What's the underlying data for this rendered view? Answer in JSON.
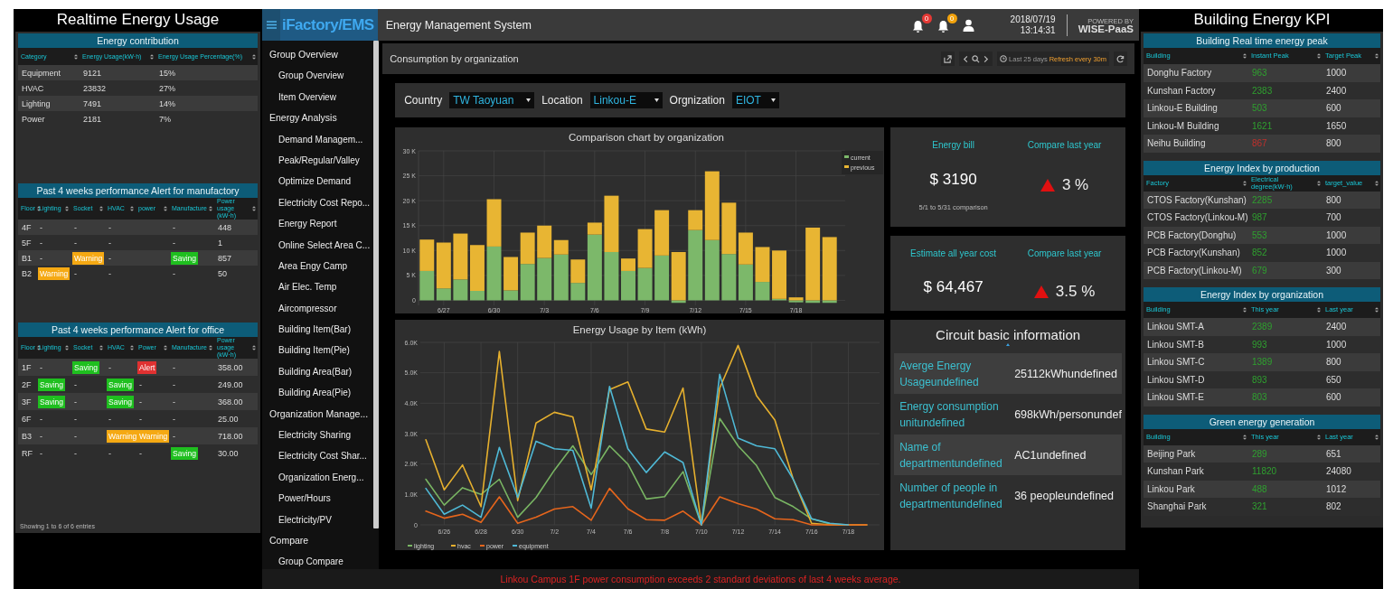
{
  "left_panel": {
    "title": "Realtime Energy Usage",
    "tables": [
      {
        "title": "Energy contribution",
        "columns": [
          "Category",
          "Energy Usage(kW·h)",
          "Energy Usage Percentage(%)"
        ],
        "rows": [
          [
            "Equipment",
            "9121",
            "15%"
          ],
          [
            "HVAC",
            "23832",
            "27%"
          ],
          [
            "Lighting",
            "7491",
            "14%"
          ],
          [
            "Power",
            "2181",
            "7%"
          ]
        ]
      },
      {
        "title": "Past 4 weeks performance Alert for manufactory",
        "columns": [
          "Floor",
          "Lighting",
          "Socket",
          "HVAC",
          "power",
          "Manufacture",
          "Power usage (kW·h)"
        ],
        "rows": [
          [
            "4F",
            "-",
            "-",
            "-",
            null,
            "-",
            "448"
          ],
          [
            "5F",
            "-",
            "-",
            "-",
            null,
            "-",
            "1"
          ],
          [
            "B1",
            "-",
            {
              "text": "Warning",
              "color": "#f5a913"
            },
            "-",
            null,
            {
              "text": "Saving",
              "color": "#1fbf1f"
            },
            "857"
          ],
          [
            "B2",
            {
              "text": "Warning",
              "color": "#f5a913"
            },
            "-",
            "-",
            null,
            "-",
            "50"
          ]
        ]
      },
      {
        "title": "Past 4 weeks performance Alert for office",
        "columns": [
          "Floor",
          "Lighting",
          "Socket",
          "HVAC",
          "Power",
          "Manufacture",
          "Power usage (kW·h)"
        ],
        "rows": [
          [
            "1F",
            "-",
            {
              "text": "Saving",
              "color": "#1fbf1f"
            },
            "-",
            {
              "text": "Alert",
              "color": "#e03131"
            },
            "-",
            "358.00"
          ],
          [
            "2F",
            {
              "text": "Saving",
              "color": "#1fbf1f"
            },
            "-",
            {
              "text": "Saving",
              "color": "#1fbf1f"
            },
            "-",
            "-",
            "249.00"
          ],
          [
            "3F",
            {
              "text": "Saving",
              "color": "#1fbf1f"
            },
            "-",
            {
              "text": "Saving",
              "color": "#1fbf1f"
            },
            "-",
            "-",
            "368.00"
          ],
          [
            "6F",
            "-",
            "-",
            "-",
            "-",
            "-",
            "25.00"
          ],
          [
            "B3",
            "-",
            "-",
            {
              "text": "Warning",
              "color": "#f5a913"
            },
            {
              "text": "Warning",
              "color": "#f5a913"
            },
            "-",
            "718.00"
          ],
          [
            "RF",
            "-",
            "-",
            "-",
            "-",
            {
              "text": "Saving",
              "color": "#1fbf1f"
            },
            "30.00"
          ]
        ]
      }
    ],
    "footer": "Showing 1 to 6 of 6 entries"
  },
  "header": {
    "logo": "iFactory/EMS",
    "title": "Energy Management System",
    "notifications": [
      {
        "count": "0",
        "color": "#e53935"
      },
      {
        "count": "0",
        "color": "#f2a20c"
      }
    ],
    "date": "2018/07/19",
    "time": "13:14:31",
    "powered_by": "POWERED BY",
    "brand": "WISE-PaaS"
  },
  "sidebar": {
    "items": [
      {
        "label": "Group Overview",
        "children": [
          {
            "label": "Group Overview"
          },
          {
            "label": "Item Overview"
          }
        ]
      },
      {
        "label": "Energy Analysis",
        "children": [
          {
            "label": "Demand Managem..."
          },
          {
            "label": "Peak/Regular/Valley"
          },
          {
            "label": "Optimize Demand"
          },
          {
            "label": "Electricity Cost Repo..."
          },
          {
            "label": "Energy Report"
          },
          {
            "label": "Online Select Area C..."
          },
          {
            "label": "Area Engy Camp"
          },
          {
            "label": "Air Elec. Temp"
          },
          {
            "label": "Aircompressor"
          },
          {
            "label": "Building Item(Bar)"
          },
          {
            "label": "Building Item(Pie)"
          },
          {
            "label": "Building Area(Bar)"
          },
          {
            "label": "Building Area(Pie)"
          }
        ]
      },
      {
        "label": "Organization Manage...",
        "children": [
          {
            "label": "Electricity Sharing"
          },
          {
            "label": "Electricity Cost Shar..."
          },
          {
            "label": "Organization Energ..."
          },
          {
            "label": "Power/Hours"
          },
          {
            "label": "Electricity/PV"
          }
        ]
      },
      {
        "label": "Compare",
        "children": [
          {
            "label": "Group Compare"
          }
        ]
      }
    ]
  },
  "page_bar": {
    "title": "Consumption by organization",
    "range": "Last 25 days",
    "refresh": "Refresh every 30m"
  },
  "filters": [
    {
      "label": "Country",
      "value": "TW Taoyuan"
    },
    {
      "label": "Location",
      "value": "Linkou-E"
    },
    {
      "label": "Orgnization",
      "value": "EIOT"
    }
  ],
  "bar_chart": {
    "chart_data": {
      "type": "bar",
      "title": "Comparison chart by organization",
      "stacked": true,
      "grid": true,
      "legend": "top-right",
      "categories": [
        null,
        "6/27",
        null,
        null,
        "6/30",
        null,
        null,
        "7/3",
        null,
        null,
        "7/6",
        null,
        null,
        "7/9",
        null,
        null,
        "7/12",
        null,
        null,
        "7/15",
        null,
        null,
        "7/18",
        null,
        null
      ],
      "series": [
        {
          "name": "current",
          "color": "#7cb86a",
          "values": [
            5900,
            2400,
            4200,
            1900,
            10800,
            2000,
            7300,
            8500,
            9200,
            3500,
            13200,
            9700,
            5900,
            6500,
            9000,
            -500,
            14100,
            12100,
            9300,
            7200,
            3700,
            300,
            -400,
            -500,
            -500
          ]
        },
        {
          "name": "previous",
          "color": "#e8b533",
          "values": [
            6300,
            9200,
            9200,
            9200,
            9500,
            6700,
            6300,
            6500,
            2900,
            4700,
            2400,
            11300,
            2500,
            7800,
            9100,
            9700,
            4000,
            13800,
            10300,
            6400,
            7000,
            9700,
            600,
            14600,
            12700
          ]
        }
      ],
      "ylim": [
        -1000,
        30000
      ],
      "yticks": [
        {
          "value": 0,
          "label": "0"
        },
        {
          "value": 5000,
          "label": "5 K"
        },
        {
          "value": 10000,
          "label": "10 K"
        },
        {
          "value": 15000,
          "label": "15 K"
        },
        {
          "value": 20000,
          "label": "20 K"
        },
        {
          "value": 25000,
          "label": "25 K"
        },
        {
          "value": 30000,
          "label": "30 K"
        }
      ]
    }
  },
  "line_chart": {
    "chart_data": {
      "type": "line",
      "title": "Energy Usage by Item (kWh)",
      "grid": true,
      "legend": "bottom",
      "categories": [
        null,
        "6/26",
        null,
        "6/28",
        null,
        "6/30",
        null,
        "7/2",
        null,
        "7/4",
        null,
        "7/6",
        null,
        "7/8",
        null,
        "7/10",
        null,
        "7/12",
        null,
        "7/14",
        null,
        "7/16",
        null,
        "7/18",
        null
      ],
      "series": [
        {
          "name": "lighting",
          "color": "#79b563",
          "values": [
            1500,
            650,
            1220,
            1000,
            1500,
            250,
            900,
            1800,
            2600,
            1650,
            2600,
            2000,
            850,
            930,
            1750,
            0,
            3500,
            2600,
            1950,
            900,
            600,
            200,
            30,
            0,
            0
          ]
        },
        {
          "name": "hvac",
          "color": "#e6b02e",
          "values": [
            2800,
            1150,
            1970,
            600,
            5700,
            800,
            3350,
            3700,
            3550,
            1150,
            4450,
            4700,
            3150,
            3050,
            4500,
            0,
            4500,
            5900,
            4250,
            3450,
            1500,
            50,
            0,
            0,
            0
          ]
        },
        {
          "name": "power",
          "color": "#e5651c",
          "values": [
            450,
            220,
            350,
            80,
            920,
            50,
            250,
            520,
            600,
            150,
            1200,
            530,
            170,
            150,
            450,
            0,
            920,
            700,
            520,
            200,
            170,
            0,
            0,
            0,
            0
          ]
        },
        {
          "name": "equipment",
          "color": "#4fb9d6",
          "values": [
            1200,
            350,
            650,
            250,
            2550,
            900,
            2750,
            2500,
            2450,
            550,
            4550,
            2500,
            1720,
            2400,
            2050,
            0,
            4950,
            2850,
            2600,
            2500,
            1500,
            200,
            50,
            0,
            null
          ]
        }
      ],
      "ylim": [
        0,
        6000
      ],
      "yticks": [
        {
          "value": 0,
          "label": "0"
        },
        {
          "value": 1000,
          "label": "1.0K"
        },
        {
          "value": 2000,
          "label": "2.0K"
        },
        {
          "value": 3000,
          "label": "3.0K"
        },
        {
          "value": 4000,
          "label": "4.0K"
        },
        {
          "value": 5000,
          "label": "5.0K"
        },
        {
          "value": 6000,
          "label": "6.0K"
        }
      ]
    }
  },
  "cost_cards": [
    {
      "label": "Energy bill",
      "value": "$ 3190",
      "note": "5/1 to 5/31 comparison",
      "compare_label": "Compare last year",
      "kind": "up",
      "change": "3 %"
    },
    {
      "label": "Estimate all year cost",
      "value": "$ 64,467",
      "compare_label": "Compare last year",
      "kind": "up",
      "change": "3.5 %"
    }
  ],
  "circuit_info": {
    "title": "Circuit basic information",
    "rows": [
      {
        "label": "Averge Energy Usageundefined",
        "value": "25112kWhundefined"
      },
      {
        "label": "Energy consumption unitundefined",
        "value": "698kWh/personundef"
      },
      {
        "label": "Name of departmentundefined",
        "value": "AC1undefined"
      },
      {
        "label": "Number of people in departmentundefined",
        "value": "36 peopleundefined"
      }
    ]
  },
  "right_panel": {
    "title": "Building Energy KPI",
    "tables": [
      {
        "title": "Building Real time energy peak",
        "columns": [
          "Building",
          "Instant Peak",
          "Target Peak"
        ],
        "rows": [
          {
            "cells": [
              "Donghu Factory",
              "963",
              "1000"
            ],
            "color": "#2fa02f"
          },
          {
            "cells": [
              "Kunshan Factory",
              "2383",
              "2400"
            ],
            "color": "#2fa02f"
          },
          {
            "cells": [
              "Linkou-E Building",
              "503",
              "600"
            ],
            "color": "#2fa02f"
          },
          {
            "cells": [
              "Linkou-M Building",
              "1621",
              "1650"
            ],
            "color": "#2fa02f"
          },
          {
            "cells": [
              "Neihu Building",
              "867",
              "800"
            ],
            "color": "#c0302c"
          }
        ]
      },
      {
        "title": "Energy Index by production",
        "columns": [
          "Factory",
          "Electrical degree(kW·h)",
          "target_value"
        ],
        "rows": [
          {
            "cells": [
              "CTOS Factory(Kunshan)",
              "2285",
              "800"
            ],
            "color": "#2fa02f"
          },
          {
            "cells": [
              "CTOS Factory(Linkou-M)",
              "987",
              "700"
            ],
            "color": "#2fa02f"
          },
          {
            "cells": [
              "PCB Factory(Donghu)",
              "553",
              "1000"
            ],
            "color": "#2fa02f"
          },
          {
            "cells": [
              "PCB Factory(Kunshan)",
              "852",
              "1000"
            ],
            "color": "#2fa02f"
          },
          {
            "cells": [
              "PCB Factory(Linkou-M)",
              "679",
              "300"
            ],
            "color": "#2fa02f"
          }
        ]
      },
      {
        "title": "Energy Index by organization",
        "columns": [
          "Building",
          "This year",
          "Last year"
        ],
        "rows": [
          {
            "cells": [
              "Linkou SMT-A",
              "2389",
              "2400"
            ],
            "color": "#2fa02f"
          },
          {
            "cells": [
              "Linkou SMT-B",
              "993",
              "1000"
            ],
            "color": "#2fa02f"
          },
          {
            "cells": [
              "Linkou SMT-C",
              "1389",
              "800"
            ],
            "color": "#2fa02f"
          },
          {
            "cells": [
              "Linkou SMT-D",
              "893",
              "650"
            ],
            "color": "#2fa02f"
          },
          {
            "cells": [
              "Linkou SMT-E",
              "803",
              "600"
            ],
            "color": "#2fa02f"
          }
        ]
      },
      {
        "title": "Green energy generation",
        "columns": [
          "Building",
          "This year",
          "Last year"
        ],
        "rows": [
          {
            "cells": [
              "Beijing Park",
              "289",
              "651"
            ],
            "color": "#2fa02f"
          },
          {
            "cells": [
              "Kunshan Park",
              "11820",
              "24080"
            ],
            "color": "#2fa02f"
          },
          {
            "cells": [
              "Linkou Park",
              "488",
              "1012"
            ],
            "color": "#2fa02f"
          },
          {
            "cells": [
              "Shanghai Park",
              "321",
              "802"
            ],
            "color": "#2fa02f"
          }
        ]
      }
    ]
  },
  "alert": "Linkou Campus 1F power consumption exceeds 2 standard deviations of last 4 weeks average."
}
